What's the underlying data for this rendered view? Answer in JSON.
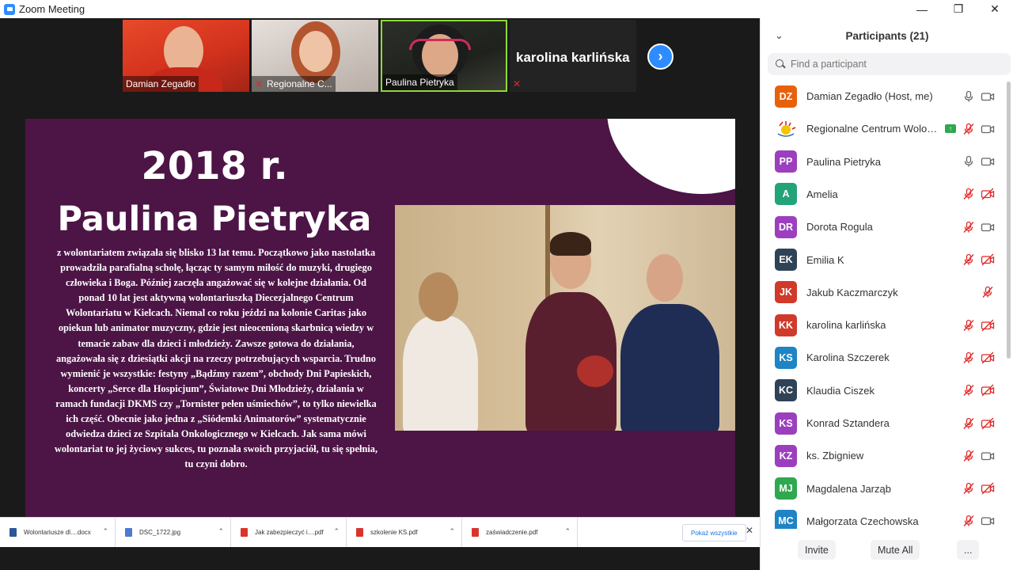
{
  "window": {
    "title": "Zoom Meeting",
    "minimize": "—",
    "maximize": "❐",
    "close": "✕"
  },
  "video_strip": {
    "tiles": [
      {
        "name": "Damian Zegadło",
        "muted": false,
        "active": false
      },
      {
        "name": "Regionalne C...",
        "muted": true,
        "active": false
      },
      {
        "name": "Paulina Pietryka",
        "muted": false,
        "active": true
      },
      {
        "name": "karolina karlińska",
        "muted": true,
        "active": false,
        "name_only": true
      }
    ],
    "next_page_arrow": "›"
  },
  "slide": {
    "year": "2018 r.",
    "person": "Paulina Pietryka",
    "bio": "z wolontariatem związała się blisko 13 lat temu. Początkowo jako nastolatka prowadziła parafialną scholę, łącząc ty samym miłość do muzyki, drugiego człowieka i Boga. Później zaczęła angażować się w kolejne działania. Od ponad 10 lat jest aktywną wolontariuszką Diecezjalnego Centrum Wolontariatu w Kielcach. Niemal co roku jeździ na kolonie Caritas jako opiekun lub animator muzyczny, gdzie jest nieocenioną skarbnicą wiedzy w temacie zabaw dla dzieci i młodzieży. Zawsze gotowa do działania, angażowała się z dziesiątki akcji na rzeczy potrzebujących wsparcia. Trudno wymienić je wszystkie: festyny „Bądźmy razem”, obchody Dni Papieskich, koncerty „Serce dla Hospicjum”, Światowe Dni Młodzieży, działania w ramach fundacji DKMS czy „Tornister pełen uśmiechów”, to tylko niewielka ich część. Obecnie jako jedna z „Siódemki Animatorów” systematycznie odwiedza dzieci ze Szpitala Onkologicznego w Kielcach. Jak sama mówi wolontariat to jej życiowy sukces, tu poznała swoich przyjaciół, tu się spełnia, tu czyni dobro.",
    "background_color": "#4c1546"
  },
  "downloads": {
    "items": [
      {
        "name": "Wolontariusze dl....docx",
        "type": "docx"
      },
      {
        "name": "DSC_1722.jpg",
        "type": "jpg"
      },
      {
        "name": "Jak zabezpieczyć i....pdf",
        "type": "pdf"
      },
      {
        "name": "szkolenie KS.pdf",
        "type": "pdf"
      },
      {
        "name": "zaświadczenie.pdf",
        "type": "pdf"
      }
    ],
    "show_all": "Pokaż wszystkie",
    "close": "✕"
  },
  "participants": {
    "title": "Participants (21)",
    "search_placeholder": "Find a participant",
    "list": [
      {
        "initials": "DZ",
        "name": "Damian Zegadło (Host, me)",
        "color": "#e8610a",
        "mic": "on",
        "cam": "on"
      },
      {
        "initials": "",
        "name": "Regionalne Centrum Wolon...",
        "color": "#ffffff",
        "mic": "off",
        "cam": "on",
        "logo": true,
        "sharing": true
      },
      {
        "initials": "PP",
        "name": "Paulina Pietryka",
        "color": "#9b3fbf",
        "mic": "on",
        "cam": "on"
      },
      {
        "initials": "A",
        "name": "Amelia",
        "color": "#23a37a",
        "mic": "off",
        "cam": "off"
      },
      {
        "initials": "DR",
        "name": "Dorota Rogula",
        "color": "#9b3fbf",
        "mic": "off",
        "cam": "on"
      },
      {
        "initials": "EK",
        "name": "Emilia K",
        "color": "#2f4357",
        "mic": "off",
        "cam": "off"
      },
      {
        "initials": "JK",
        "name": "Jakub Kaczmarczyk",
        "color": "#d03a2a",
        "mic": "off",
        "cam": "none"
      },
      {
        "initials": "KK",
        "name": "karolina karlińska",
        "color": "#d03a2a",
        "mic": "off",
        "cam": "off"
      },
      {
        "initials": "KS",
        "name": "Karolina Szczerek",
        "color": "#1e84c6",
        "mic": "off",
        "cam": "off"
      },
      {
        "initials": "KC",
        "name": "Klaudia Ciszek",
        "color": "#2f4357",
        "mic": "off",
        "cam": "off"
      },
      {
        "initials": "KS",
        "name": "Konrad Sztandera",
        "color": "#9b3fbf",
        "mic": "off",
        "cam": "off"
      },
      {
        "initials": "KZ",
        "name": "ks. Zbigniew",
        "color": "#9b3fbf",
        "mic": "off",
        "cam": "on"
      },
      {
        "initials": "MJ",
        "name": "Magdalena Jarząb",
        "color": "#2fa84f",
        "mic": "off",
        "cam": "off"
      },
      {
        "initials": "MC",
        "name": "Małgorzata Czechowska",
        "color": "#1e84c6",
        "mic": "off",
        "cam": "on"
      }
    ],
    "footer": {
      "invite": "Invite",
      "mute_all": "Mute All",
      "more": "..."
    }
  }
}
